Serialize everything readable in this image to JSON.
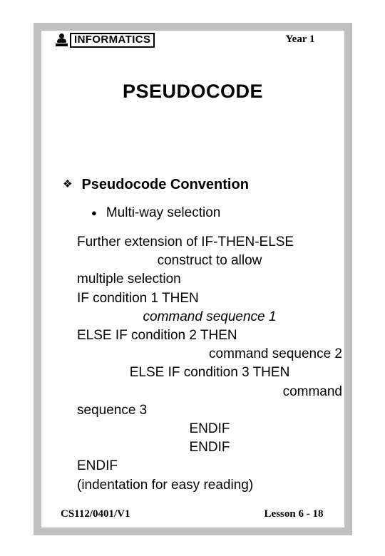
{
  "header": {
    "logo_text": "INFORMATICS",
    "logo_icon": "person-bust-icon",
    "year_label": "Year 1"
  },
  "title": "PSEUDOCODE",
  "bullets": {
    "level1": {
      "marker": "❖",
      "text": "Pseudocode Convention"
    },
    "level2": {
      "marker": "●",
      "text": "Multi-way selection"
    }
  },
  "code_lines": [
    {
      "text": "Further extension of IF-THEN-ELSE",
      "align": "left",
      "italic": false
    },
    {
      "text": "construct to allow",
      "align": "center",
      "italic": false
    },
    {
      "text": "multiple selection",
      "align": "left",
      "italic": false
    },
    {
      "text": "IF condition 1 THEN",
      "align": "left",
      "italic": false
    },
    {
      "text": "command sequence 1",
      "align": "center",
      "italic": true
    },
    {
      "text": "ELSE IF condition 2 THEN",
      "align": "left",
      "italic": false
    },
    {
      "text": "command sequence 2",
      "align": "right",
      "italic": false
    },
    {
      "text": "ELSE IF condition 3 THEN",
      "align": "center",
      "italic": false
    },
    {
      "text": "command",
      "align": "right",
      "italic": false
    },
    {
      "text": "sequence 3",
      "align": "left",
      "italic": false
    },
    {
      "text": "ENDIF",
      "align": "center",
      "italic": false
    },
    {
      "text": "ENDIF",
      "align": "center",
      "italic": false
    },
    {
      "text": "ENDIF",
      "align": "left",
      "italic": false
    },
    {
      "text": "(indentation for easy reading)",
      "align": "left",
      "italic": false
    }
  ],
  "footer": {
    "course_code": "CS112/0401/V1",
    "lesson_label": "Lesson 6 - 18"
  },
  "colors": {
    "frame": "#c0c0c0",
    "text": "#000000",
    "background": "#ffffff"
  }
}
